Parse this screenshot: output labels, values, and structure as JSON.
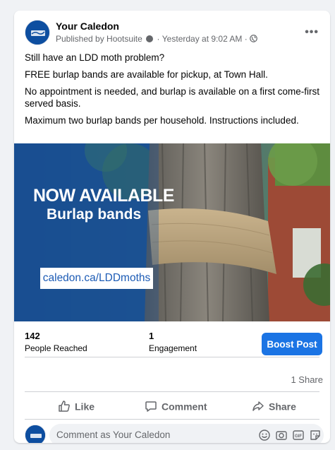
{
  "post": {
    "page_name": "Your Caledon",
    "publisher": "Published by Hootsuite",
    "time": "Yesterday at 9:02 AM",
    "separator": "·",
    "more_icon": "more-options-icon",
    "paragraphs": [
      "Still have an LDD moth problem?",
      "FREE burlap bands are available for pickup, at Town Hall.",
      "No appointment is needed, and burlap is available on a first come-first served basis.",
      "Maximum two burlap bands per household. Instructions included."
    ]
  },
  "image": {
    "headline": "NOW AVAILABLE",
    "subhead": "Burlap bands",
    "url": "caledon.ca/LDDmoths"
  },
  "stats": {
    "reach_count": "142",
    "reach_label": "People Reached",
    "engagement_count": "1",
    "engagement_label": "Engagement",
    "boost_label": "Boost Post"
  },
  "shares": "1 Share",
  "actions": {
    "like": "Like",
    "comment": "Comment",
    "share": "Share"
  },
  "comment_box": {
    "placeholder": "Comment as Your Caledon",
    "icons": [
      "emoji-icon",
      "camera-icon",
      "gif-icon",
      "sticker-icon"
    ]
  },
  "colors": {
    "accent": "#1b74e4",
    "brand_blue": "#0d4ea0",
    "muted": "#65676b"
  }
}
